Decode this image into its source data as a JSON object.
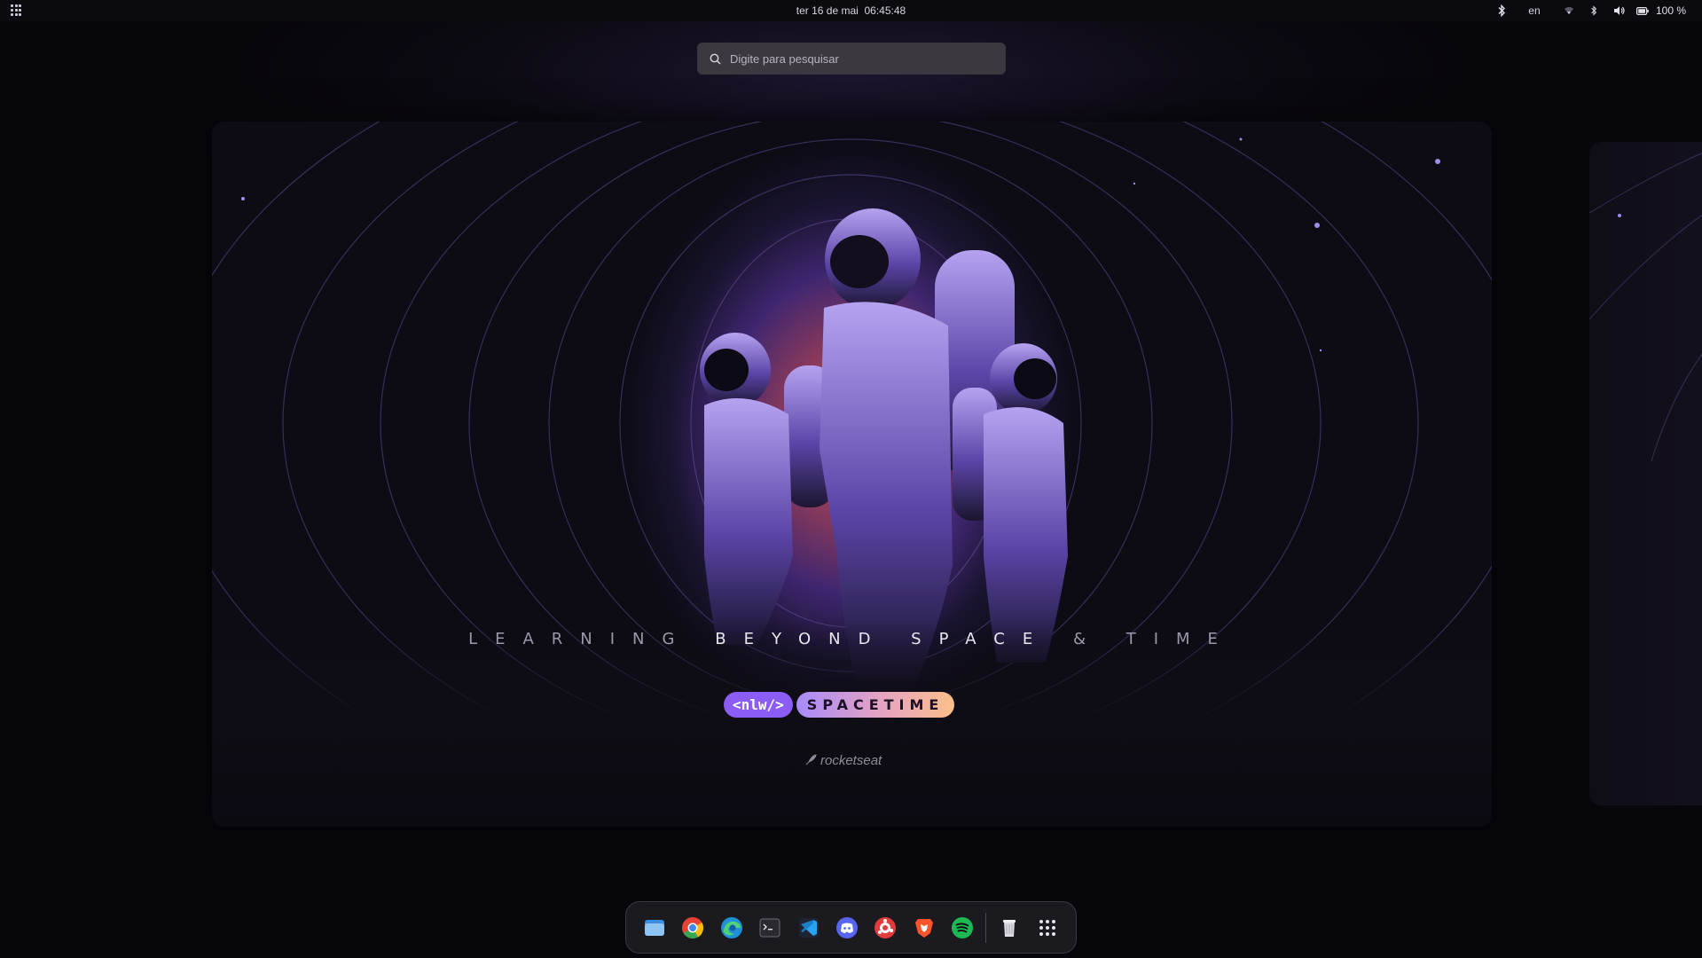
{
  "topbar": {
    "date": "ter 16 de mai",
    "time": "06:45:48",
    "keyboard_layout": "en",
    "battery": "100 %"
  },
  "search": {
    "placeholder": "Digite para pesquisar"
  },
  "wallpaper": {
    "tagline_dim": "LEARNING",
    "tagline_bright": "BEYOND SPACE",
    "tagline_dim2": "& TIME",
    "badge_code": "<nlw/>",
    "badge_title": "SPACETIME",
    "brand": "rocketseat"
  },
  "dock": {
    "apps": [
      {
        "name": "files-icon"
      },
      {
        "name": "chrome-icon"
      },
      {
        "name": "edge-icon"
      },
      {
        "name": "terminal-icon"
      },
      {
        "name": "vscode-icon"
      },
      {
        "name": "discord-icon"
      },
      {
        "name": "figma-icon"
      },
      {
        "name": "brave-icon"
      },
      {
        "name": "spotify-icon"
      },
      {
        "name": "trash-icon"
      },
      {
        "name": "show-apps-icon"
      }
    ]
  },
  "colors": {
    "accent_purple": "#8b5cf6",
    "glow_orange": "#d2582d",
    "topbar_bg": "#0b0a0f",
    "dock_bg": "#1c1b20"
  }
}
